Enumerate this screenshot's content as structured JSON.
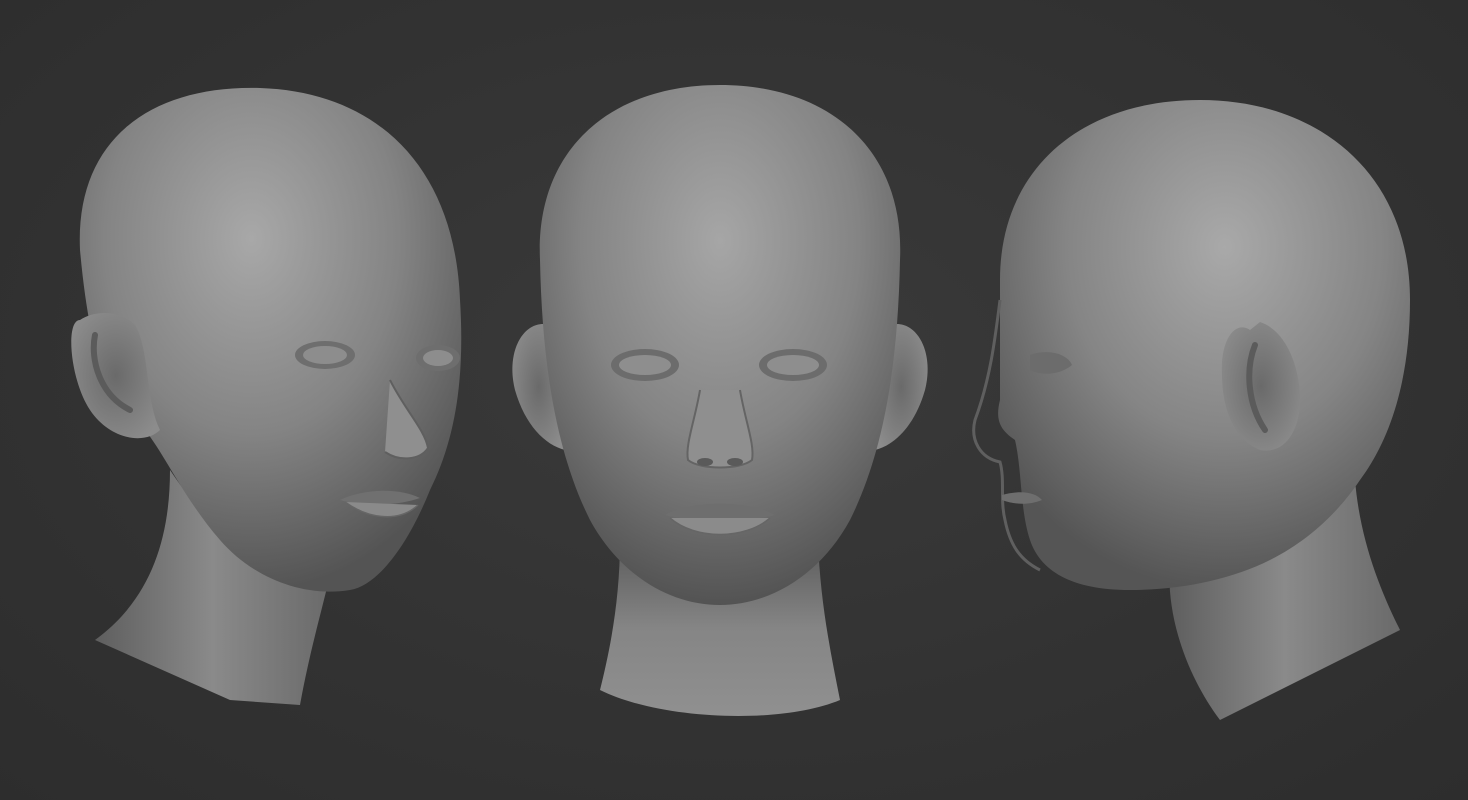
{
  "scene": {
    "background": "#333333",
    "clay_light": "#9b9b9b",
    "clay_mid": "#7a7a7a",
    "clay_dark": "#4a4a4a",
    "views": [
      {
        "id": "three-quarter",
        "icon": "head-three-quarter-view"
      },
      {
        "id": "front",
        "icon": "head-front-view"
      },
      {
        "id": "profile",
        "icon": "head-profile-view"
      }
    ]
  }
}
